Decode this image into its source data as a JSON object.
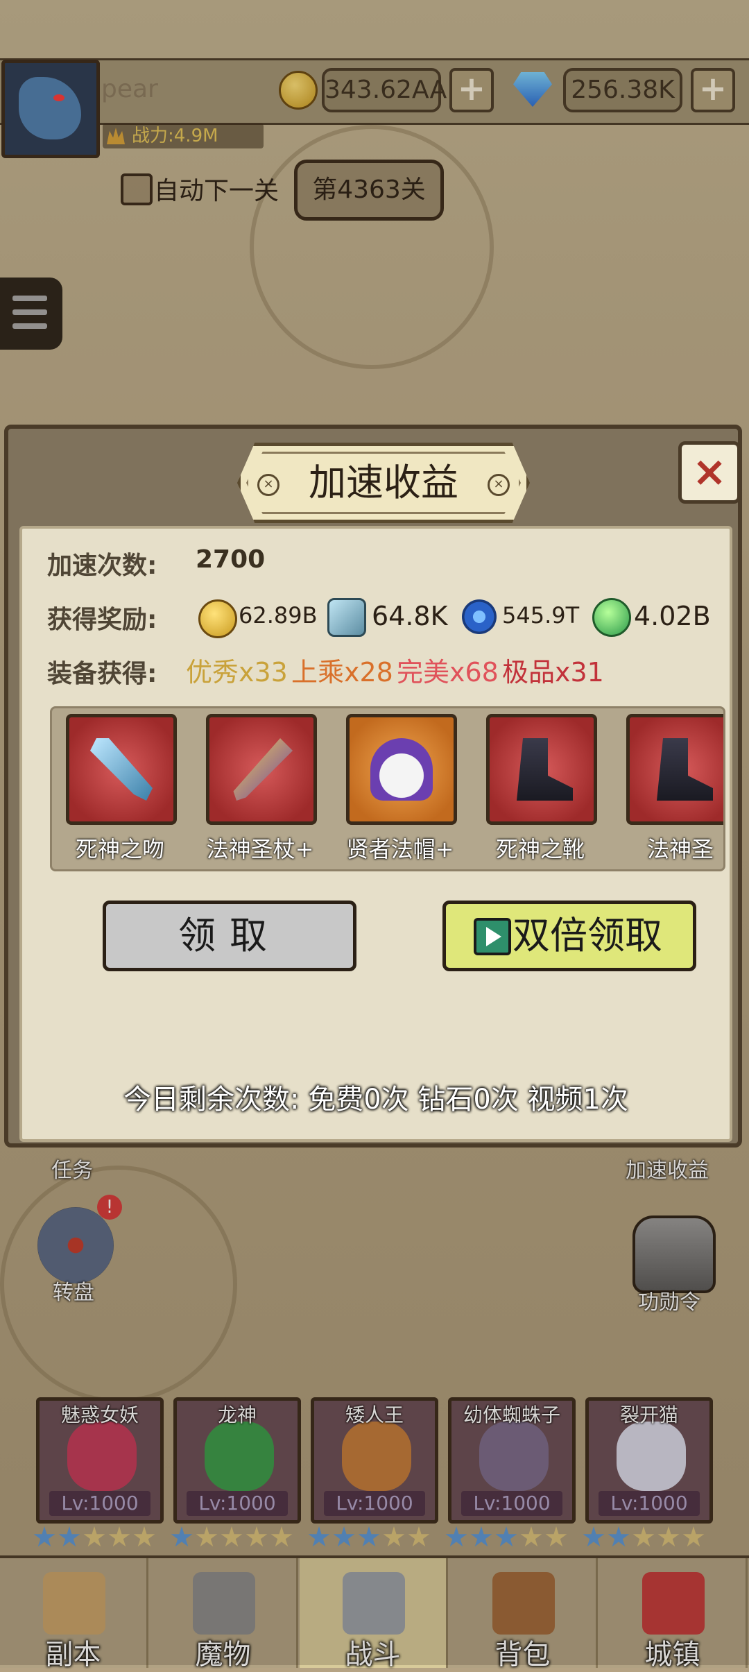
{
  "header": {
    "username": "pear",
    "power": "战力:4.9M",
    "gold": "343.62AA",
    "diamonds": "256.38K",
    "plus": "+"
  },
  "stage": {
    "auto_next_label": "自动下一关",
    "level_label": "第4363关"
  },
  "modal": {
    "title": "加速收益",
    "close": "×",
    "speedup_label": "加速次数:",
    "speedup_count": "2700",
    "reward_label": "获得奖励:",
    "rewards": [
      "62.89B",
      "64.8K",
      "545.9T",
      "4.02B"
    ],
    "equip_label": "装备获得:",
    "grades": [
      {
        "text": "优秀x33",
        "color": "#c9a23a"
      },
      {
        "text": "上乘x28",
        "color": "#d9702a"
      },
      {
        "text": "完美x68",
        "color": "#e0525a"
      },
      {
        "text": "极品x31",
        "color": "#c2323a"
      }
    ],
    "equipment": [
      {
        "name": "死神之吻",
        "rarity": "red",
        "icon": "dagger-icon"
      },
      {
        "name": "法神圣杖+",
        "rarity": "red",
        "icon": "staff-icon"
      },
      {
        "name": "贤者法帽+",
        "rarity": "orange",
        "icon": "hat-icon"
      },
      {
        "name": "死神之靴",
        "rarity": "red",
        "icon": "boots-icon"
      },
      {
        "name": "法神圣",
        "rarity": "red",
        "icon": "boots-icon"
      }
    ],
    "claim_button": "领取",
    "double_button": "双倍领取",
    "remaining": "今日剩余次数:  免费0次  钻石0次  视频1次"
  },
  "side": {
    "task": "任务",
    "wheel": "转盘",
    "speedup": "加速收益",
    "merit": "功勋令"
  },
  "heroes": [
    {
      "name": "魅惑女妖",
      "level": "Lv:1000",
      "blue_stars": 2,
      "gold_stars": 3
    },
    {
      "name": "龙神",
      "level": "Lv:1000",
      "blue_stars": 1,
      "gold_stars": 4
    },
    {
      "name": "矮人王",
      "level": "Lv:1000",
      "blue_stars": 3,
      "gold_stars": 2
    },
    {
      "name": "幼体蜘蛛子",
      "level": "Lv:1000",
      "blue_stars": 3,
      "gold_stars": 2
    },
    {
      "name": "裂开猫",
      "level": "Lv:1000",
      "blue_stars": 2,
      "gold_stars": 3
    }
  ],
  "nav": [
    {
      "label": "副本",
      "icon": "map-icon"
    },
    {
      "label": "魔物",
      "icon": "monster-icon"
    },
    {
      "label": "战斗",
      "icon": "swords-icon",
      "active": true
    },
    {
      "label": "背包",
      "icon": "backpack-icon"
    },
    {
      "label": "城镇",
      "icon": "shop-icon"
    }
  ]
}
